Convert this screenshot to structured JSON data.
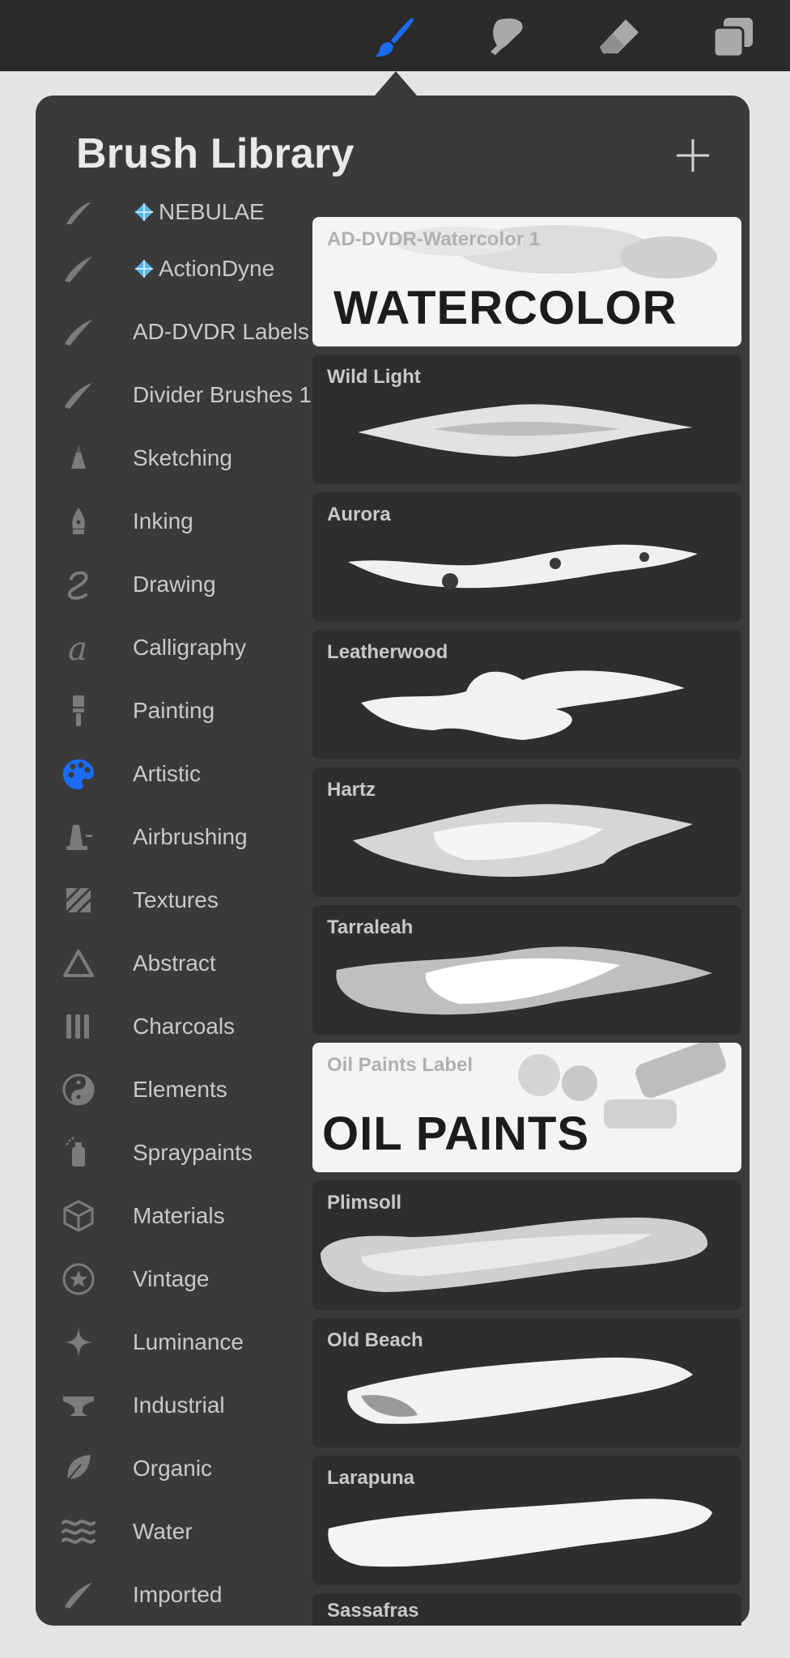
{
  "toolbar": {
    "tools": [
      {
        "name": "brush",
        "active": true
      },
      {
        "name": "smudge",
        "active": false
      },
      {
        "name": "eraser",
        "active": false
      },
      {
        "name": "layers",
        "active": false
      }
    ],
    "accent_color": "#1a6cf5"
  },
  "panel": {
    "title": "Brush Library",
    "add_label": "+"
  },
  "brush_sets": [
    {
      "label": "NEBULAE",
      "icon": "stroke-icon",
      "gem": true
    },
    {
      "label": "ActionDyne",
      "icon": "stroke-icon",
      "gem": true
    },
    {
      "label": "AD-DVDR Labels",
      "icon": "stroke-icon"
    },
    {
      "label": "Divider Brushes 1",
      "icon": "stroke-icon"
    },
    {
      "label": "Sketching",
      "icon": "pencil-tip-icon"
    },
    {
      "label": "Inking",
      "icon": "pen-nib-icon"
    },
    {
      "label": "Drawing",
      "icon": "squiggle-icon"
    },
    {
      "label": "Calligraphy",
      "icon": "calligraphy-a-icon"
    },
    {
      "label": "Painting",
      "icon": "paintbrush-icon"
    },
    {
      "label": "Artistic",
      "icon": "palette-icon",
      "active": true
    },
    {
      "label": "Airbrushing",
      "icon": "airbrush-icon"
    },
    {
      "label": "Textures",
      "icon": "hatch-icon"
    },
    {
      "label": "Abstract",
      "icon": "triangle-icon"
    },
    {
      "label": "Charcoals",
      "icon": "charcoal-sticks-icon"
    },
    {
      "label": "Elements",
      "icon": "yin-yang-icon"
    },
    {
      "label": "Spraypaints",
      "icon": "spray-can-icon"
    },
    {
      "label": "Materials",
      "icon": "cube-icon"
    },
    {
      "label": "Vintage",
      "icon": "star-badge-icon"
    },
    {
      "label": "Luminance",
      "icon": "sparkle-icon"
    },
    {
      "label": "Industrial",
      "icon": "anvil-icon"
    },
    {
      "label": "Organic",
      "icon": "leaf-icon"
    },
    {
      "label": "Water",
      "icon": "waves-icon"
    },
    {
      "label": "Imported",
      "icon": "stroke-icon"
    }
  ],
  "brushes": [
    {
      "name": "AD-DVDR-Watercolor 1",
      "type": "label",
      "big_text": "WATERCOLOR"
    },
    {
      "name": "Wild Light",
      "type": "stroke"
    },
    {
      "name": "Aurora",
      "type": "stroke"
    },
    {
      "name": "Leatherwood",
      "type": "stroke"
    },
    {
      "name": "Hartz",
      "type": "stroke"
    },
    {
      "name": "Tarraleah",
      "type": "stroke"
    },
    {
      "name": "Oil Paints Label",
      "type": "label",
      "big_text": "OIL PAINTS"
    },
    {
      "name": "Plimsoll",
      "type": "stroke"
    },
    {
      "name": "Old Beach",
      "type": "stroke"
    },
    {
      "name": "Larapuna",
      "type": "stroke"
    },
    {
      "name": "Sassafras",
      "type": "stroke"
    }
  ]
}
